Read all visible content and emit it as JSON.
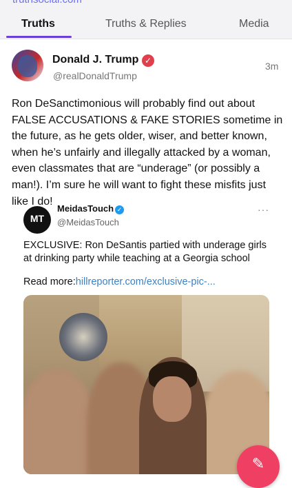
{
  "url_strip": "truthsocial.com",
  "tabs": [
    {
      "label": "Truths",
      "active": true
    },
    {
      "label": "Truths & Replies",
      "active": false
    },
    {
      "label": "Media",
      "active": false
    }
  ],
  "post": {
    "author_name": "Donald J. Trump",
    "author_handle": "@realDonaldTrump",
    "time": "3m",
    "text": "Ron DeSanctimonious will probably find out about FALSE ACCUSATIONS & FAKE STORIES sometime in the future, as he gets older, wiser, and better known, when he’s unfairly and illegally attacked by a woman, even classmates that are “underage” (or possibly a man!). I’m sure he will want to fight these misfits just like I do!"
  },
  "embed": {
    "logo_text": "MT",
    "name": "MeidasTouch",
    "handle": "@MeidasTouch",
    "more": "···",
    "text": "EXCLUSIVE: Ron DeSantis partied with underage girls at drinking party while teaching at a Georgia school",
    "readmore_label": "Read more:",
    "link_text": "hillreporter.com/exclusive-pic-..."
  },
  "colors": {
    "accent": "#6b3fd6",
    "verified": "#e0404b",
    "fab": "#ef4063",
    "link": "#3b82c4"
  }
}
